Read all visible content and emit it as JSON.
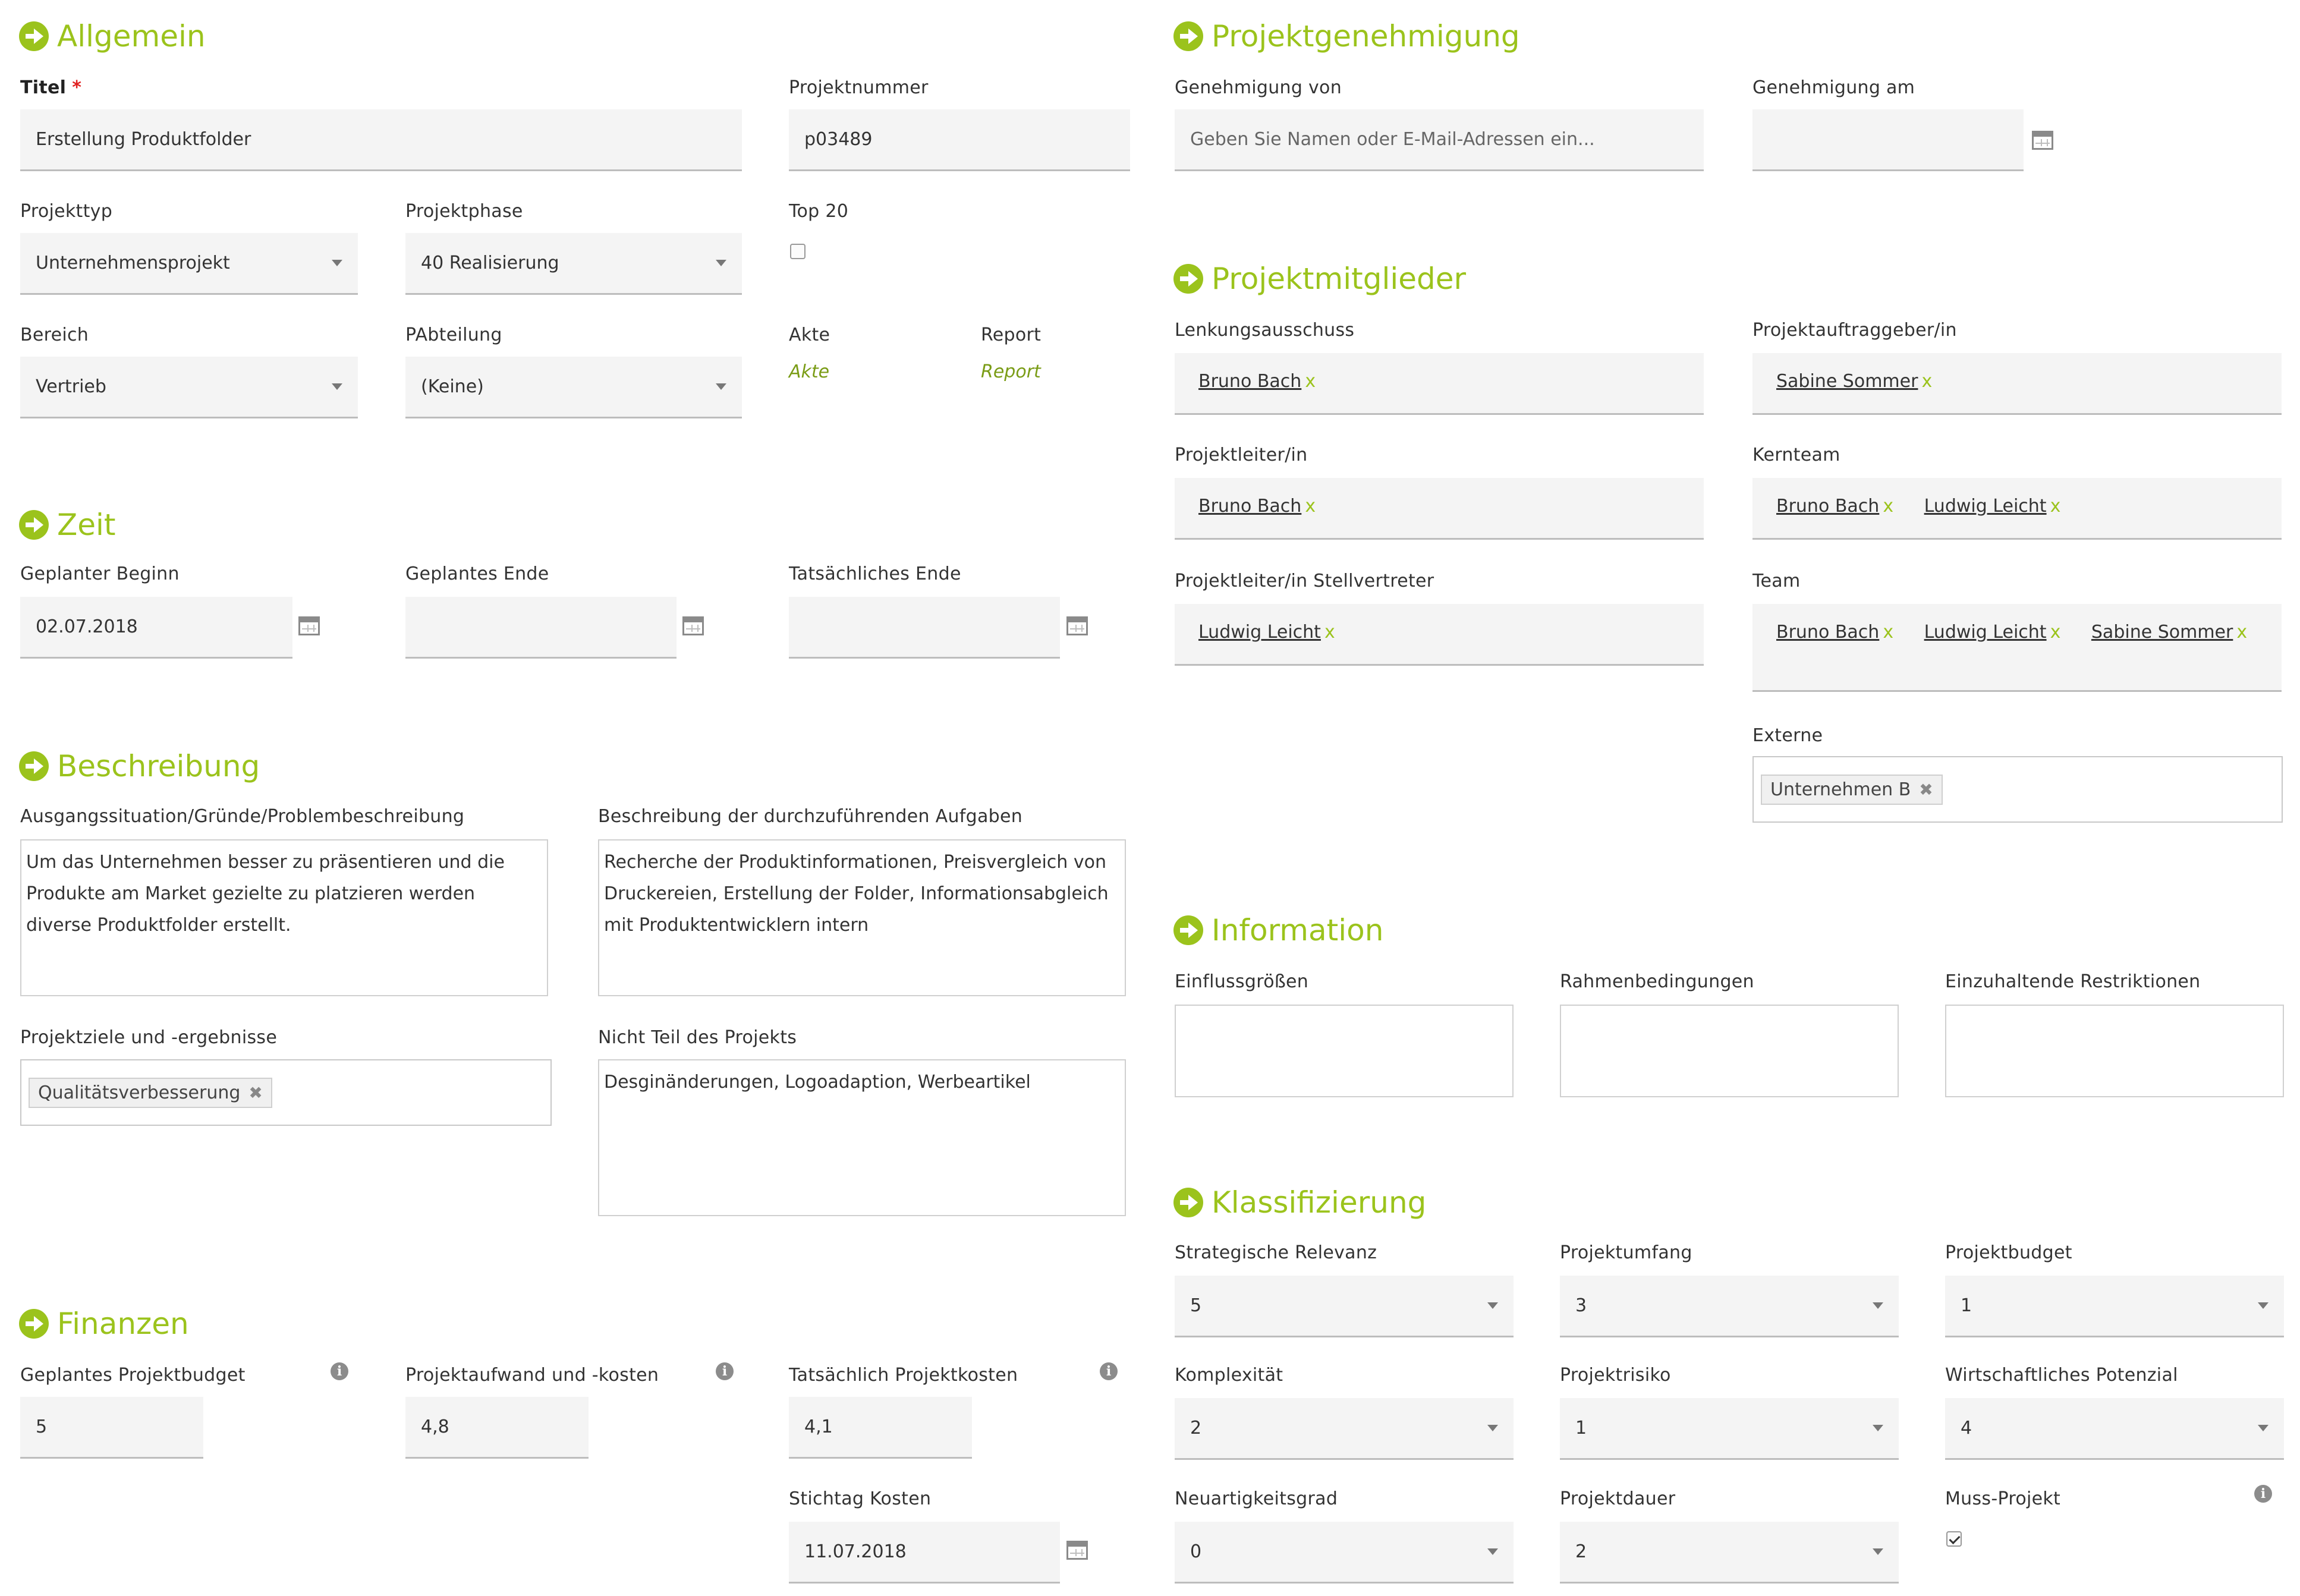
{
  "colors": {
    "accent": "#9bc31c",
    "required": "#e02020"
  },
  "allgemein": {
    "title": "Allgemein",
    "titel_label": "Titel",
    "required_mark": "*",
    "titel_value": "Erstellung Produktfolder",
    "projektnummer_label": "Projektnummer",
    "projektnummer_value": "p03489",
    "projekttyp_label": "Projekttyp",
    "projekttyp_value": "Unternehmensprojekt",
    "projektphase_label": "Projektphase",
    "projektphase_value": "40 Realisierung",
    "top20_label": "Top 20",
    "top20_checked": false,
    "bereich_label": "Bereich",
    "bereich_value": "Vertrieb",
    "pabteilung_label": "PAbteilung",
    "pabteilung_value": "(Keine)",
    "akte_label": "Akte",
    "akte_link": "Akte",
    "report_label": "Report",
    "report_link": "Report"
  },
  "zeit": {
    "title": "Zeit",
    "beginn_label": "Geplanter Beginn",
    "beginn_value": "02.07.2018",
    "ende_label": "Geplantes Ende",
    "ende_value": "",
    "tatsaechlich_label": "Tatsächliches Ende",
    "tatsaechlich_value": ""
  },
  "beschreibung": {
    "title": "Beschreibung",
    "ausgang_label": "Ausgangssituation/Gründe/Problembeschreibung",
    "ausgang_lines": [
      "Um das Unternehmen besser zu präsentieren und die",
      "Produkte am Market gezielte zu platzieren werden",
      "diverse Produktfolder erstellt."
    ],
    "aufgaben_label": "Beschreibung der durchzuführenden Aufgaben",
    "aufgaben_lines": [
      "Recherche der Produktinformationen, Preisvergleich von",
      "Druckereien, Erstellung der Folder, Informationsabgleich",
      "mit Produktentwicklern intern"
    ],
    "ziele_label": "Projektziele und -ergebnisse",
    "ziele_tag": "Qualitätsverbesserung",
    "nicht_label": "Nicht Teil des Projekts",
    "nicht_text": "Desginänderungen, Logoadaption, Werbeartikel"
  },
  "finanzen": {
    "title": "Finanzen",
    "budget_label": "Geplantes Projektbudget",
    "budget_value": "5",
    "aufwand_label": "Projektaufwand und -kosten",
    "aufwand_value": "4,8",
    "kosten_label": "Tatsächlich Projektkosten",
    "kosten_value": "4,1",
    "stichtag_label": "Stichtag Kosten",
    "stichtag_value": "11.07.2018",
    "info_glyph": "i"
  },
  "genehmigung": {
    "title": "Projektgenehmigung",
    "von_label": "Genehmigung von",
    "von_placeholder": "Geben Sie Namen oder E-Mail-Adressen ein...",
    "am_label": "Genehmigung am",
    "am_value": ""
  },
  "mitglieder": {
    "title": "Projektmitglieder",
    "x_glyph": "x",
    "lenkung_label": "Lenkungsausschuss",
    "lenkung": [
      "Bruno Bach"
    ],
    "auftraggeber_label": "Projektauftraggeber/in",
    "auftraggeber": [
      "Sabine Sommer"
    ],
    "leiter_label": "Projektleiter/in",
    "leiter": [
      "Bruno Bach"
    ],
    "kernteam_label": "Kernteam",
    "kernteam": [
      "Bruno Bach",
      "Ludwig Leicht"
    ],
    "stellv_label": "Projektleiter/in Stellvertreter",
    "stellv": [
      "Ludwig Leicht"
    ],
    "team_label": "Team",
    "team": [
      "Bruno Bach",
      "Ludwig Leicht",
      "Sabine Sommer"
    ],
    "externe_label": "Externe",
    "externe_tag": "Unternehmen B"
  },
  "information": {
    "title": "Information",
    "einfluss_label": "Einflussgrößen",
    "rahmen_label": "Rahmenbedingungen",
    "restrik_label": "Einzuhaltende Restriktionen"
  },
  "klassifizierung": {
    "title": "Klassifizierung",
    "relevanz_label": "Strategische Relevanz",
    "relevanz_value": "5",
    "umfang_label": "Projektumfang",
    "umfang_value": "3",
    "budget_label": "Projektbudget",
    "budget_value": "1",
    "komplex_label": "Komplexität",
    "komplex_value": "2",
    "risiko_label": "Projektrisiko",
    "risiko_value": "1",
    "potenzial_label": "Wirtschaftliches Potenzial",
    "potenzial_value": "4",
    "neu_label": "Neuartigkeitsgrad",
    "neu_value": "0",
    "dauer_label": "Projektdauer",
    "dauer_value": "2",
    "muss_label": "Muss-Projekt",
    "muss_checked": true
  }
}
